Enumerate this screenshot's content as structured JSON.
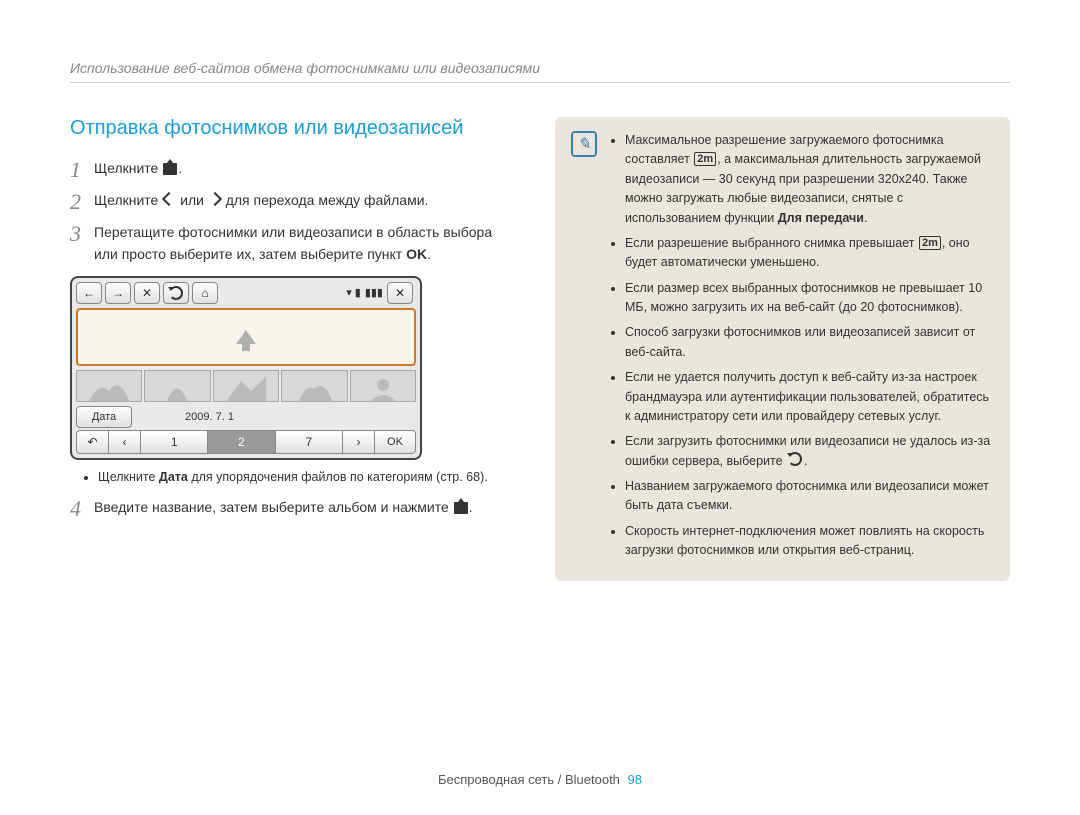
{
  "breadcrumb": "Использование веб-сайтов обмена фотоснимками или видеозаписями",
  "section_title": "Отправка фотоснимков или видеозаписей",
  "steps": [
    {
      "num": "1",
      "pre": "Щелкните ",
      "post": "."
    },
    {
      "num": "2",
      "pre": "Щелкните ",
      "mid": " или ",
      "post": " для перехода между файлами."
    },
    {
      "num": "3",
      "text": "Перетащите фотоснимки или видеозаписи в область выбора или просто выберите их, затем выберите пункт ",
      "bold": "OK",
      "end": "."
    },
    {
      "num": "4",
      "text": "Введите название, затем выберите альбом и нажмите ",
      "end": "."
    }
  ],
  "sub_note_pre": "Щелкните ",
  "sub_note_bold": "Дата",
  "sub_note_post": " для упорядочения файлов по категориям (стр. 68).",
  "device": {
    "date_button": "Дата",
    "date_value": "2009. 7. 1",
    "pager_nums": [
      "1",
      "2",
      "7"
    ],
    "ok": "OK"
  },
  "res_label": "2m",
  "notes": {
    "n1a": "Максимальное разрешение загружаемого фотоснимка составляет ",
    "n1b": ", а максимальная длительность загружаемой видеозаписи — 30 секунд при разрешении 320x240. Также можно загружать любые видеозаписи, снятые с использованием функции ",
    "n1bold": "Для передачи",
    "n1c": ".",
    "n2a": "Если разрешение выбранного снимка превышает ",
    "n2b": ", оно будет автоматически уменьшено.",
    "n3": "Если размер всех выбранных фотоснимков не превышает 10 МБ, можно загрузить их на веб-сайт (до 20 фотоснимков).",
    "n4": "Способ загрузки фотоснимков или видеозаписей зависит от веб-сайта.",
    "n5": "Если не удается получить доступ к веб-сайту из-за настроек брандмауэра или аутентификации пользователей, обратитесь к администратору сети или провайдеру сетевых услуг.",
    "n6a": "Если загрузить фотоснимки или видеозаписи не удалось из-за ошибки сервера, выберите ",
    "n6b": ".",
    "n7": "Названием загружаемого фотоснимка или видеозаписи может быть дата съемки.",
    "n8": "Скорость интернет-подключения может повлиять на скорость загрузки фотоснимков или открытия веб-страниц."
  },
  "footer_text": "Беспроводная сеть / Bluetooth",
  "footer_page": "98"
}
